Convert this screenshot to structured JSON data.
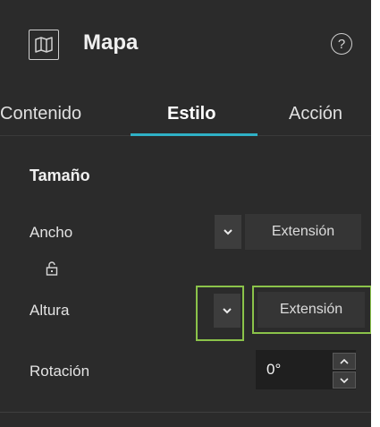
{
  "header": {
    "title": "Mapa",
    "map_icon": "map-icon",
    "help_icon": "help-icon",
    "help_glyph": "?"
  },
  "tabs": [
    {
      "label": "Contenido",
      "active": false
    },
    {
      "label": "Estilo",
      "active": true
    },
    {
      "label": "Acción",
      "active": false
    }
  ],
  "section": {
    "title": "Tamaño"
  },
  "width_row": {
    "label": "Ancho",
    "value": "Extensión"
  },
  "height_row": {
    "label": "Altura",
    "value": "Extensión"
  },
  "rotation_row": {
    "label": "Rotación",
    "value": "0°"
  },
  "colors": {
    "accent": "#2fb1c6",
    "highlight": "#8bc34a",
    "panel_bg": "#2b2b2b"
  }
}
